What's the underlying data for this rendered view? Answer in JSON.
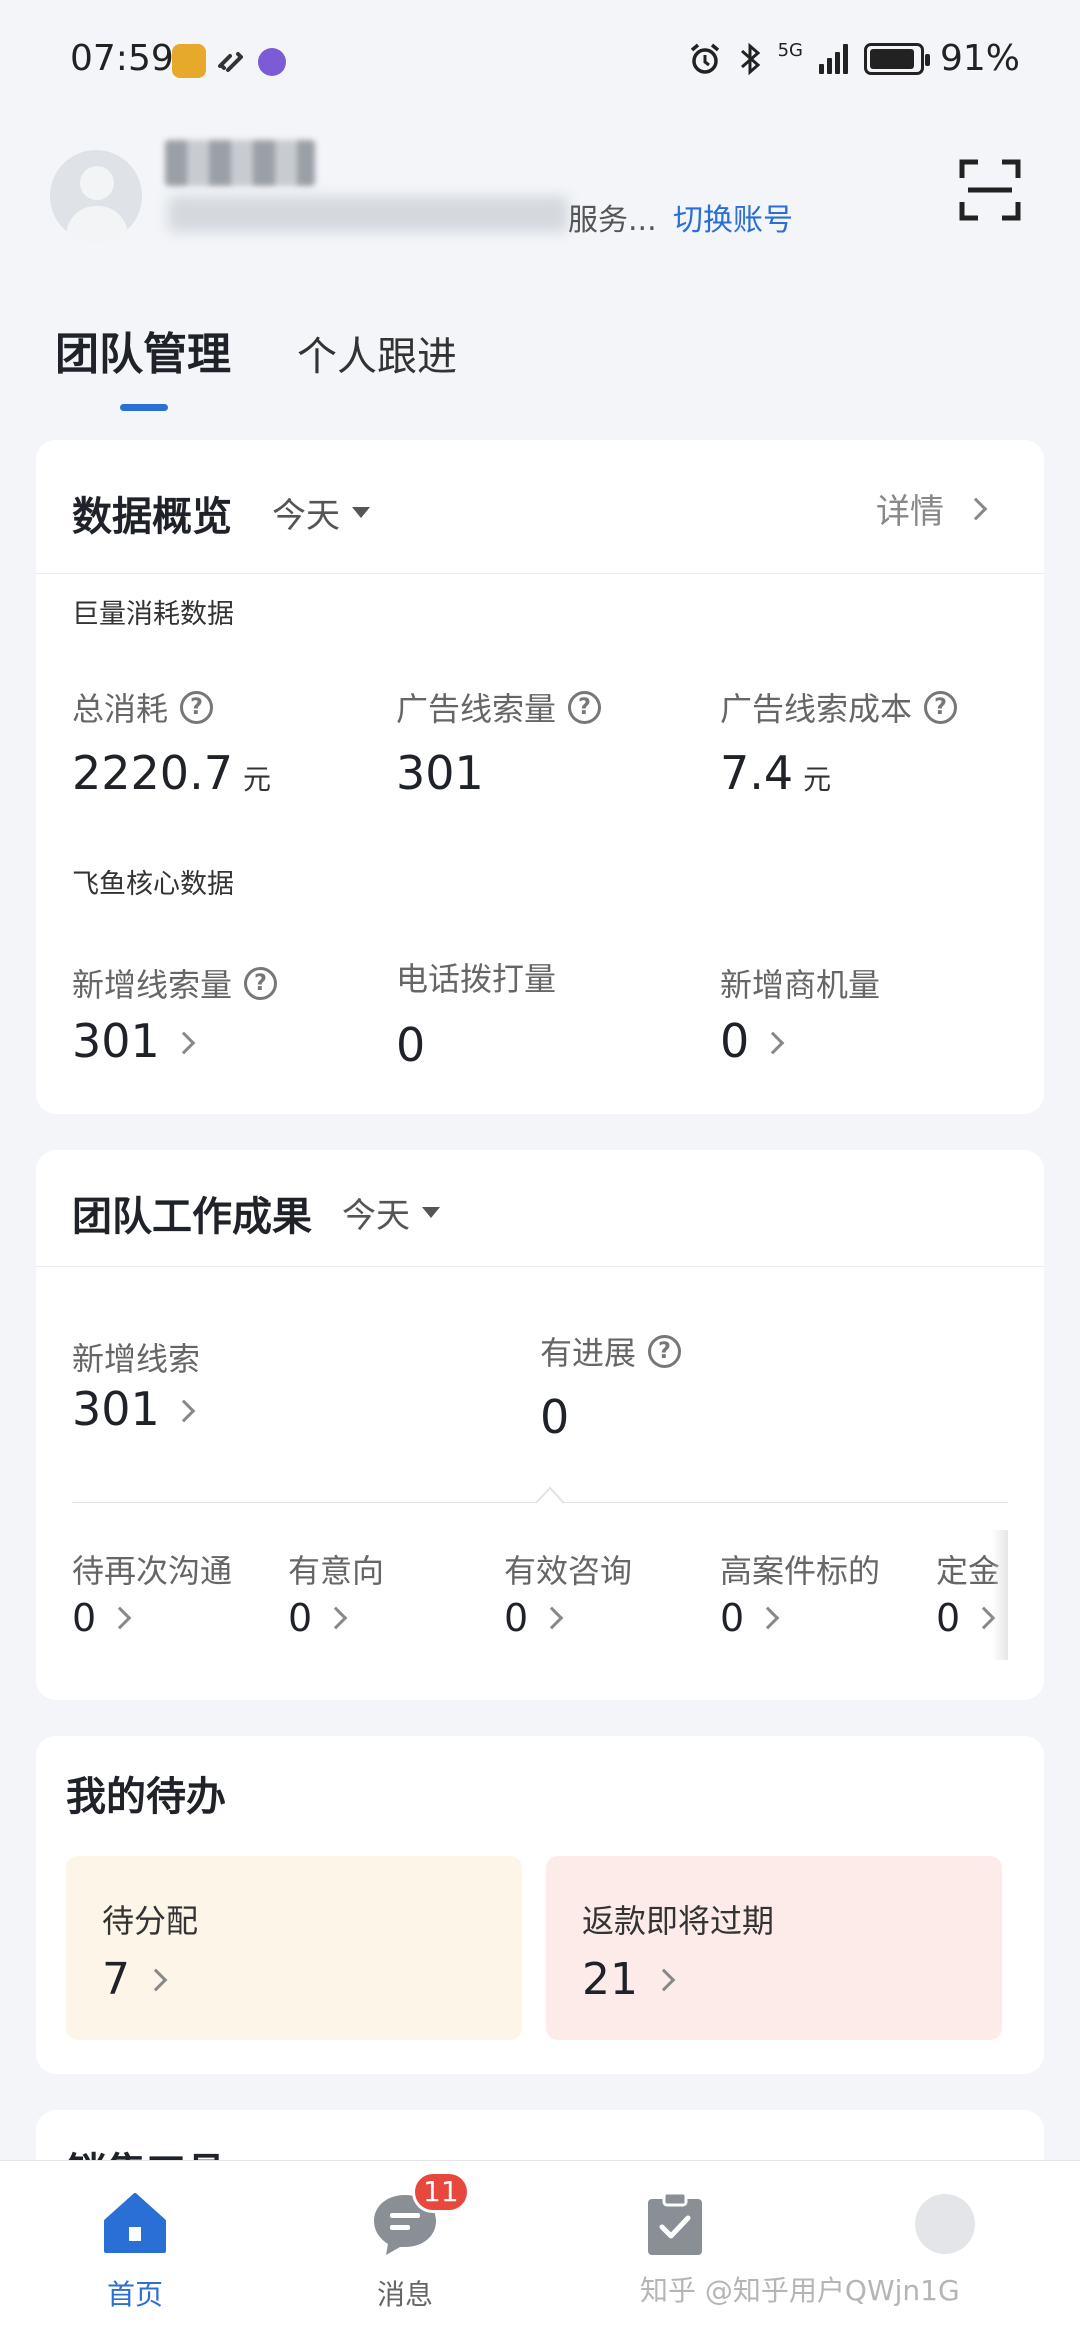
{
  "status_bar": {
    "time": "07:59",
    "network": "5G",
    "battery_percent": "91%",
    "battery_level": 0.91
  },
  "account": {
    "org_suffix": "服务...",
    "switch_label": "切换账号"
  },
  "tabs": [
    {
      "label": "团队管理",
      "active": true
    },
    {
      "label": "个人跟进",
      "active": false
    }
  ],
  "overview": {
    "title": "数据概览",
    "range": "今天",
    "detail_label": "详情",
    "juliang_section": "巨量消耗数据",
    "juliang_metrics": [
      {
        "label": "总消耗",
        "value": "2220.7",
        "unit": "元"
      },
      {
        "label": "广告线索量",
        "value": "301",
        "unit": ""
      },
      {
        "label": "广告线索成本",
        "value": "7.4",
        "unit": "元"
      }
    ],
    "feiyu_section": "飞鱼核心数据",
    "feiyu_metrics": [
      {
        "label": "新增线索量",
        "value": "301"
      },
      {
        "label": "电话拨打量",
        "value": "0"
      },
      {
        "label": "新增商机量",
        "value": "0"
      }
    ]
  },
  "team_results": {
    "title": "团队工作成果",
    "range": "今天",
    "primary": [
      {
        "label": "新增线索",
        "value": "301"
      },
      {
        "label": "有进展",
        "value": "0"
      }
    ],
    "stages": [
      {
        "label": "待再次沟通",
        "value": "0"
      },
      {
        "label": "有意向",
        "value": "0"
      },
      {
        "label": "有效咨询",
        "value": "0"
      },
      {
        "label": "高案件标的",
        "value": "0"
      },
      {
        "label": "定金",
        "value": "0"
      }
    ]
  },
  "todo": {
    "title": "我的待办",
    "items": [
      {
        "label": "待分配",
        "value": "7"
      },
      {
        "label": "返款即将过期",
        "value": "21"
      }
    ]
  },
  "sales_tools": {
    "title": "销售工具"
  },
  "bottom_nav": {
    "items": [
      {
        "label": "首页",
        "icon": "home-icon"
      },
      {
        "label": "消息",
        "icon": "message-icon"
      },
      {
        "label": "",
        "icon": "clipboard-check-icon"
      },
      {
        "label": "",
        "icon": "more-icon"
      }
    ],
    "message_badge": "11"
  },
  "watermark": "知乎 @知乎用户QWjn1G",
  "colors": {
    "accent": "#2a6fd6",
    "background": "#f3f5f8",
    "badge": "#e8473d",
    "todo_orange_bg": "#fdf5e7",
    "todo_red_bg": "#fdebea"
  }
}
